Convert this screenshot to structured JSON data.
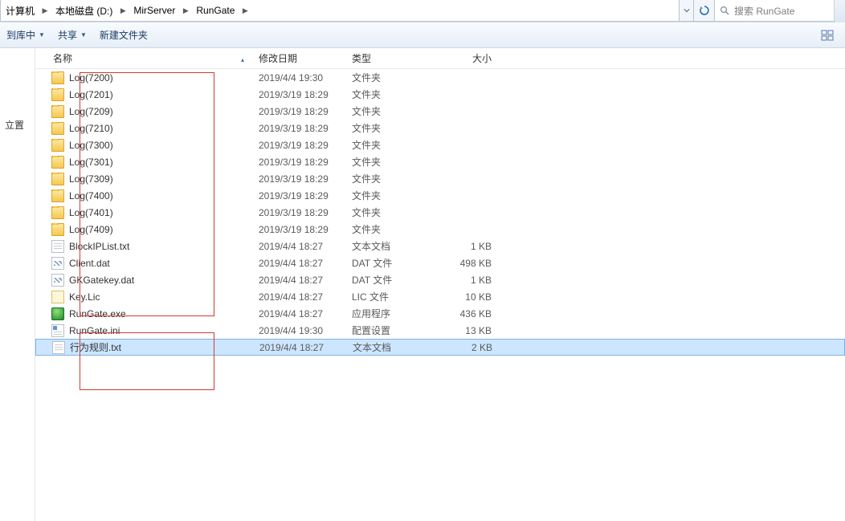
{
  "breadcrumb": [
    {
      "label": "计算机"
    },
    {
      "label": "本地磁盘 (D:)"
    },
    {
      "label": "MirServer"
    },
    {
      "label": "RunGate"
    }
  ],
  "search": {
    "placeholder": "搜索 RunGate"
  },
  "toolbar": {
    "include": "到库中",
    "share": "共享",
    "newfolder": "新建文件夹"
  },
  "nav": {
    "location": "立置"
  },
  "columns": {
    "name": "名称",
    "date": "修改日期",
    "type": "类型",
    "size": "大小"
  },
  "files": [
    {
      "icon": "folder",
      "name": "Log(7200)",
      "date": "2019/4/4 19:30",
      "type": "文件夹",
      "size": ""
    },
    {
      "icon": "folder",
      "name": "Log(7201)",
      "date": "2019/3/19 18:29",
      "type": "文件夹",
      "size": ""
    },
    {
      "icon": "folder",
      "name": "Log(7209)",
      "date": "2019/3/19 18:29",
      "type": "文件夹",
      "size": ""
    },
    {
      "icon": "folder",
      "name": "Log(7210)",
      "date": "2019/3/19 18:29",
      "type": "文件夹",
      "size": ""
    },
    {
      "icon": "folder",
      "name": "Log(7300)",
      "date": "2019/3/19 18:29",
      "type": "文件夹",
      "size": ""
    },
    {
      "icon": "folder",
      "name": "Log(7301)",
      "date": "2019/3/19 18:29",
      "type": "文件夹",
      "size": ""
    },
    {
      "icon": "folder",
      "name": "Log(7309)",
      "date": "2019/3/19 18:29",
      "type": "文件夹",
      "size": ""
    },
    {
      "icon": "folder",
      "name": "Log(7400)",
      "date": "2019/3/19 18:29",
      "type": "文件夹",
      "size": ""
    },
    {
      "icon": "folder",
      "name": "Log(7401)",
      "date": "2019/3/19 18:29",
      "type": "文件夹",
      "size": ""
    },
    {
      "icon": "folder",
      "name": "Log(7409)",
      "date": "2019/3/19 18:29",
      "type": "文件夹",
      "size": ""
    },
    {
      "icon": "txt",
      "name": "BlockIPList.txt",
      "date": "2019/4/4 18:27",
      "type": "文本文档",
      "size": "1 KB"
    },
    {
      "icon": "dat",
      "name": "Client.dat",
      "date": "2019/4/4 18:27",
      "type": "DAT 文件",
      "size": "498 KB"
    },
    {
      "icon": "dat",
      "name": "GKGatekey.dat",
      "date": "2019/4/4 18:27",
      "type": "DAT 文件",
      "size": "1 KB"
    },
    {
      "icon": "lic",
      "name": "Key.Lic",
      "date": "2019/4/4 18:27",
      "type": "LIC 文件",
      "size": "10 KB"
    },
    {
      "icon": "exe",
      "name": "RunGate.exe",
      "date": "2019/4/4 18:27",
      "type": "应用程序",
      "size": "436 KB"
    },
    {
      "icon": "ini",
      "name": "RunGate.ini",
      "date": "2019/4/4 19:30",
      "type": "配置设置",
      "size": "13 KB"
    },
    {
      "icon": "txt",
      "name": "行为规则.txt",
      "date": "2019/4/4 18:27",
      "type": "文本文档",
      "size": "2 KB",
      "selected": true
    }
  ]
}
